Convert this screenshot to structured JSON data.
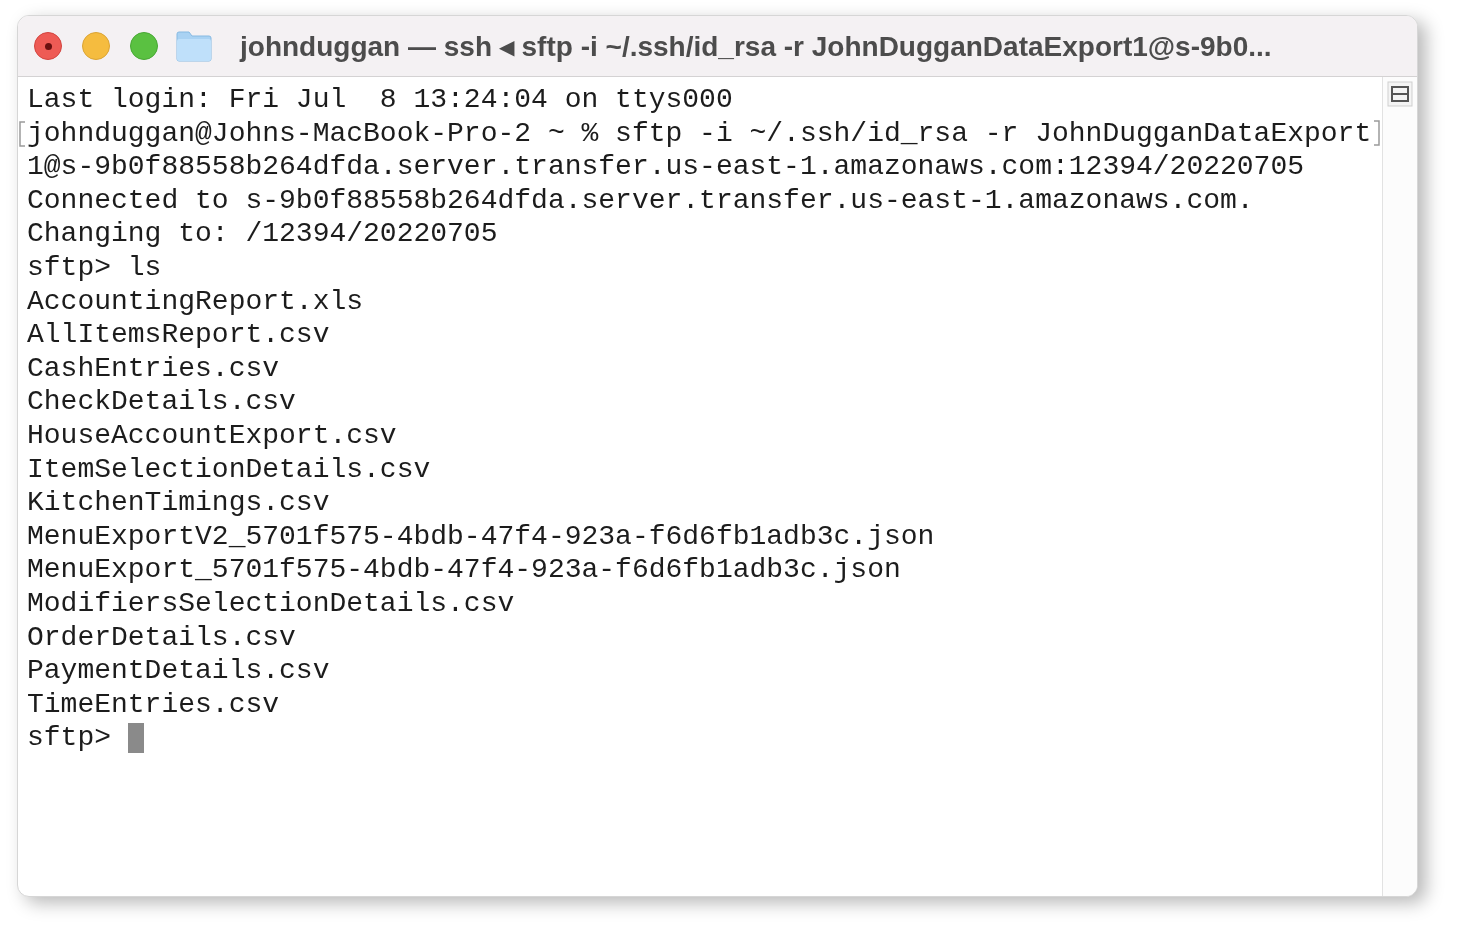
{
  "window": {
    "title": "johnduggan — ssh ◂ sftp -i ~/.ssh/id_rsa -r JohnDugganDataExport1@s-9b0..."
  },
  "terminal": {
    "lines": [
      {
        "text": "Last login: Fri Jul  8 13:24:04 on ttys000",
        "marked": false
      },
      {
        "text": "johnduggan@Johns-MacBook-Pro-2 ~ % sftp -i ~/.ssh/id_rsa -r JohnDugganDataExport",
        "marked": true
      },
      {
        "text": "1@s-9b0f88558b264dfda.server.transfer.us-east-1.amazonaws.com:12394/20220705",
        "marked": false
      },
      {
        "text": "Connected to s-9b0f88558b264dfda.server.transfer.us-east-1.amazonaws.com.",
        "marked": false
      },
      {
        "text": "Changing to: /12394/20220705",
        "marked": false
      },
      {
        "text": "sftp> ls",
        "marked": false
      },
      {
        "text": "AccountingReport.xls",
        "marked": false
      },
      {
        "text": "AllItemsReport.csv",
        "marked": false
      },
      {
        "text": "CashEntries.csv",
        "marked": false
      },
      {
        "text": "CheckDetails.csv",
        "marked": false
      },
      {
        "text": "HouseAccountExport.csv",
        "marked": false
      },
      {
        "text": "ItemSelectionDetails.csv",
        "marked": false
      },
      {
        "text": "KitchenTimings.csv",
        "marked": false
      },
      {
        "text": "MenuExportV2_5701f575-4bdb-47f4-923a-f6d6fb1adb3c.json",
        "marked": false
      },
      {
        "text": "MenuExport_5701f575-4bdb-47f4-923a-f6d6fb1adb3c.json",
        "marked": false
      },
      {
        "text": "ModifiersSelectionDetails.csv",
        "marked": false
      },
      {
        "text": "OrderDetails.csv",
        "marked": false
      },
      {
        "text": "PaymentDetails.csv",
        "marked": false
      },
      {
        "text": "TimeEntries.csv",
        "marked": false
      }
    ],
    "prompt": {
      "text": "sftp>",
      "cursor": true
    }
  }
}
